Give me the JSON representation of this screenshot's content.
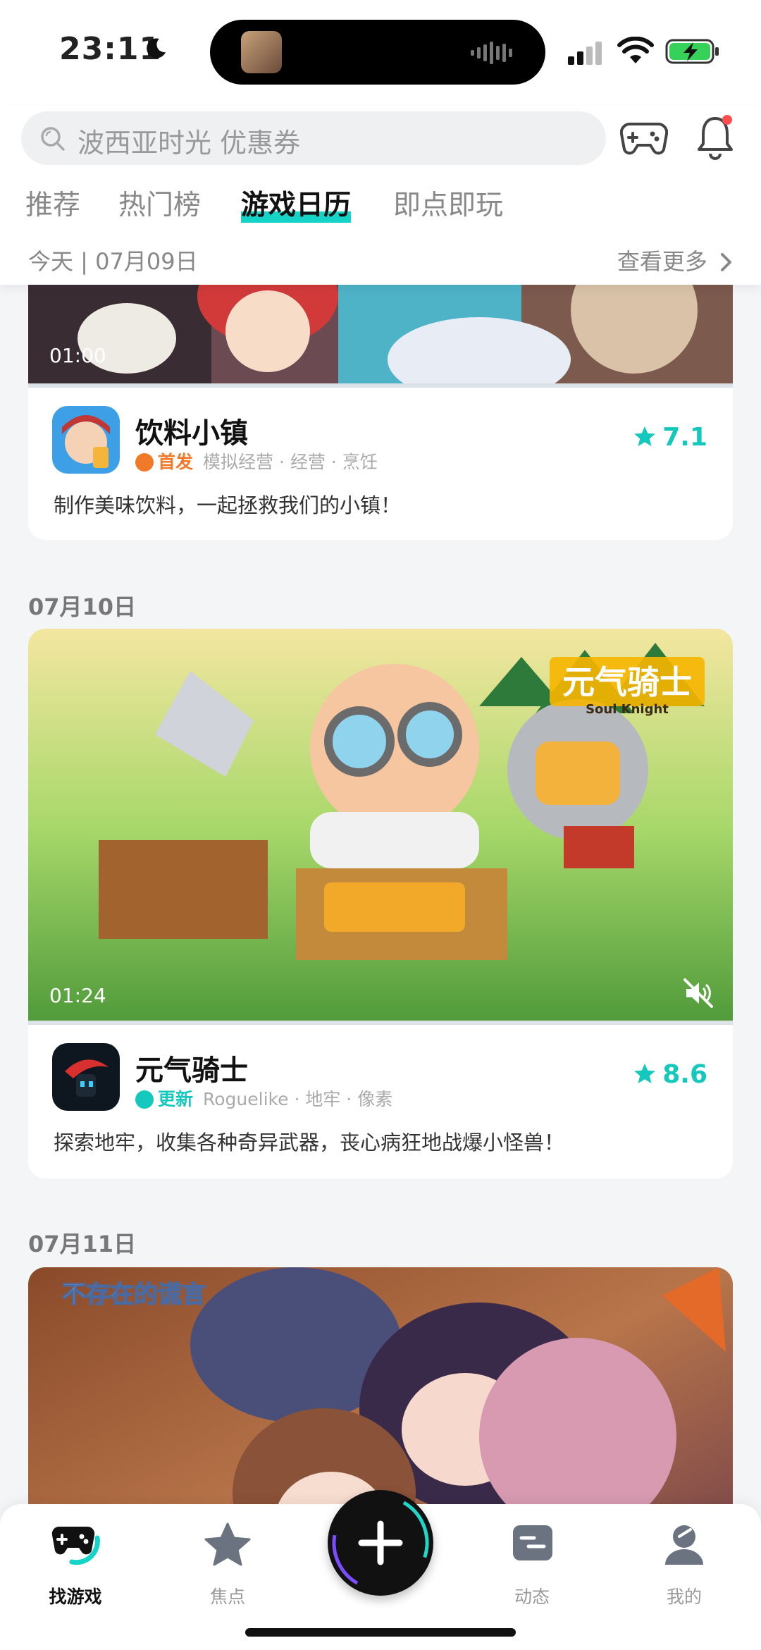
{
  "status_bar": {
    "time": "23:11"
  },
  "search": {
    "placeholder": "波西亚时光 优惠券"
  },
  "tabs": [
    {
      "label": "推荐"
    },
    {
      "label": "热门榜"
    },
    {
      "label": "游戏日历"
    },
    {
      "label": "即点即玩"
    }
  ],
  "date_header": {
    "label": "今天 | 07月09日",
    "more": "查看更多"
  },
  "cards": [
    {
      "video_duration": "01:00",
      "app_name": "饮料小镇",
      "badge": "首发",
      "badge_color": "#f07a2a",
      "tags": "模拟经营 · 经营 · 烹饪",
      "rating": "7.1",
      "description": "制作美味饮料，一起拯救我们的小镇！"
    },
    {
      "section_date": "07月10日",
      "video_duration": "01:24",
      "banner_title": "元气骑士",
      "banner_subtitle": "Soul Knight",
      "app_name": "元气骑士",
      "badge": "更新",
      "badge_color": "#14c8bd",
      "tags": "Roguelike · 地牢 · 像素",
      "rating": "8.6",
      "description": "探索地牢，收集各种奇异武器，丧心病狂地战爆小怪兽！"
    },
    {
      "section_date": "07月11日",
      "banner_title": "不存在的谎言"
    }
  ],
  "bottom_nav": [
    {
      "label": "找游戏",
      "icon": "gamepad-icon"
    },
    {
      "label": "焦点",
      "icon": "star-icon"
    },
    {
      "label": "",
      "icon": "plus-icon"
    },
    {
      "label": "动态",
      "icon": "message-icon"
    },
    {
      "label": "我的",
      "icon": "profile-icon"
    }
  ],
  "accent_color": "#16d3c7"
}
